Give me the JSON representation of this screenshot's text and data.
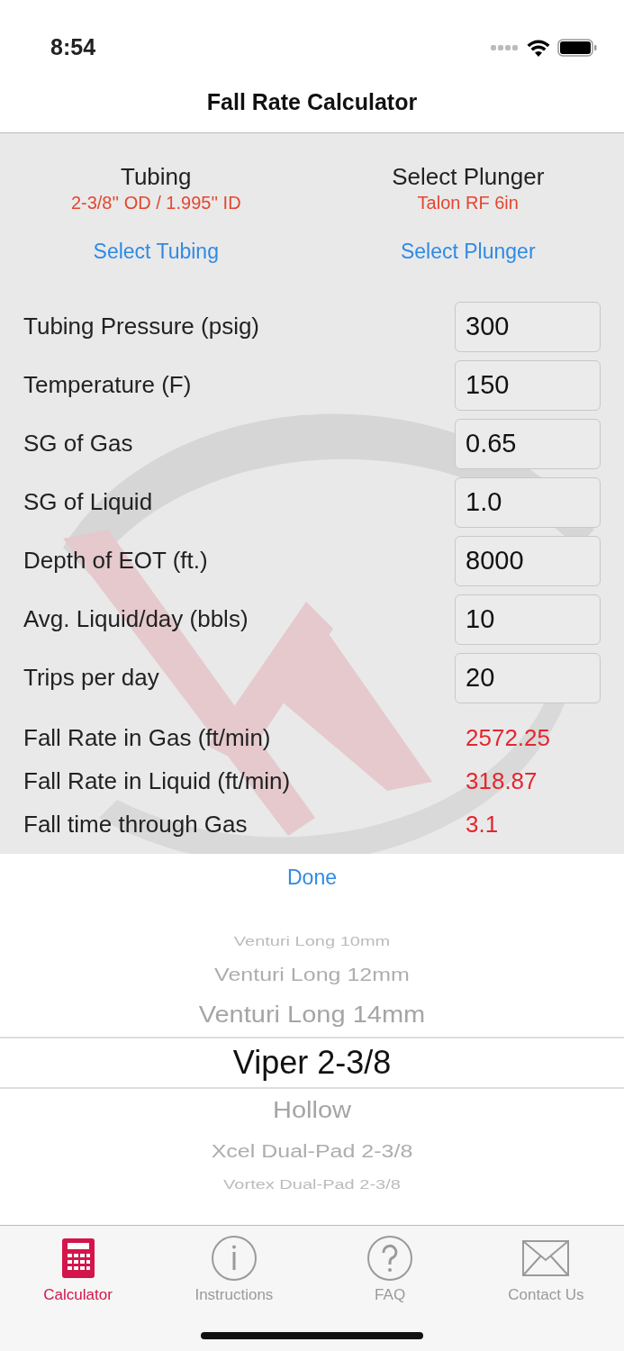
{
  "status_bar": {
    "time": "8:54"
  },
  "nav_bar": {
    "title": "Fall Rate Calculator"
  },
  "selectors": [
    {
      "title": "Tubing",
      "value": "2-3/8'' OD / 1.995'' ID",
      "action": "Select Tubing"
    },
    {
      "title": "Select Plunger",
      "value": "Talon RF 6in",
      "action": "Select Plunger"
    }
  ],
  "inputs": [
    {
      "label": "Tubing Pressure (psig)",
      "value": "300"
    },
    {
      "label": "Temperature (F)",
      "value": "150"
    },
    {
      "label": "SG of Gas",
      "value": "0.65"
    },
    {
      "label": "SG of Liquid",
      "value": "1.0"
    },
    {
      "label": "Depth of EOT (ft.)",
      "value": "8000"
    },
    {
      "label": "Avg. Liquid/day (bbls)",
      "value": "10"
    },
    {
      "label": "Trips per day",
      "value": "20"
    }
  ],
  "results": [
    {
      "label": "Fall Rate in Gas (ft/min)",
      "value": "2572.25"
    },
    {
      "label": "Fall Rate in Liquid (ft/min)",
      "value": "318.87"
    },
    {
      "label": "Fall time through Gas",
      "value": "3.1"
    }
  ],
  "picker": {
    "done": "Done",
    "items": [
      {
        "label": "Venturi Long 10mm",
        "selected": false
      },
      {
        "label": "Venturi Long 12mm",
        "selected": false
      },
      {
        "label": "Venturi Long 14mm",
        "selected": false
      },
      {
        "label": "Viper 2-3/8",
        "selected": true
      },
      {
        "label": "Hollow",
        "selected": false
      },
      {
        "label": "Xcel Dual-Pad 2-3/8",
        "selected": false
      },
      {
        "label": "Vortex Dual-Pad 2-3/8",
        "selected": false
      }
    ]
  },
  "tab_bar": [
    {
      "label": "Calculator",
      "kind": "calculator",
      "selected": true
    },
    {
      "label": "Instructions",
      "kind": "info",
      "selected": false
    },
    {
      "label": "FAQ",
      "kind": "question",
      "selected": false
    },
    {
      "label": "Contact Us",
      "kind": "mail",
      "selected": false
    }
  ]
}
